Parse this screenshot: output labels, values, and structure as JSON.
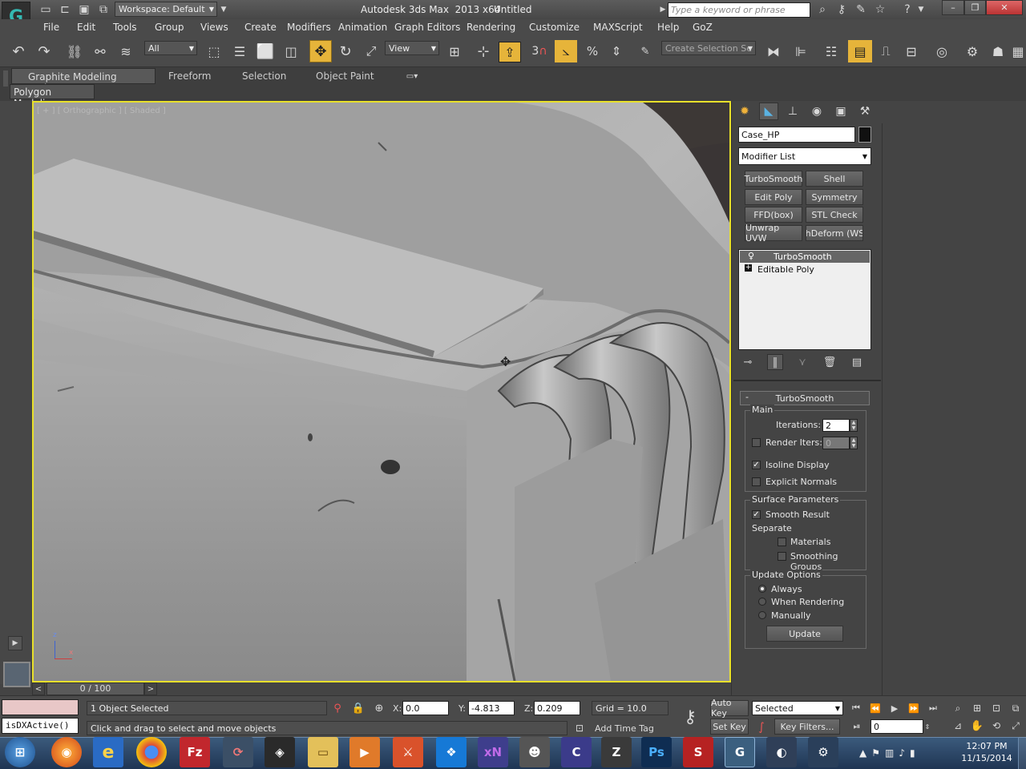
{
  "titlebar": {
    "workspace": "Workspace: Default",
    "app_title": "Autodesk 3ds Max  2013 x64",
    "doc_title": "Untitled",
    "search_placeholder": "Type a keyword or phrase"
  },
  "menubar": {
    "items": [
      "File",
      "Edit",
      "Tools",
      "Group",
      "Views",
      "Create",
      "Modifiers",
      "Animation",
      "Graph Editors",
      "Rendering",
      "Customize",
      "MAXScript",
      "Help",
      "GoZ"
    ]
  },
  "toolbar": {
    "selection_filter": "All",
    "reference_coord": "View",
    "snap_value": "3",
    "named_selection_placeholder": "Create Selection Se"
  },
  "ribbon": {
    "tabs": [
      "Graphite Modeling Tools",
      "Freeform",
      "Selection",
      "Object Paint"
    ],
    "sub_tab": "Polygon Modeling"
  },
  "viewport": {
    "label": "[ + ] [ Orthographic ] [ Shaded ]",
    "axis_x": "x",
    "axis_z": "z"
  },
  "command_panel": {
    "object_name": "Case_HP",
    "object_color": "#111111",
    "modifier_list": "Modifier List",
    "modifier_buttons": [
      "TurboSmooth",
      "Shell",
      "Edit Poly",
      "Symmetry",
      "FFD(box)",
      "STL Check",
      "Unwrap UVW",
      "thDeform (WSI"
    ],
    "stack": [
      {
        "name": "TurboSmooth",
        "selected": true
      },
      {
        "name": "Editable Poly",
        "selected": false
      }
    ]
  },
  "turbosmooth": {
    "rollout_title": "TurboSmooth",
    "collapse_symbol": "-",
    "main_label": "Main",
    "iterations_label": "Iterations:",
    "iterations_value": "2",
    "render_iters_label": "Render Iters:",
    "render_iters_value": "0",
    "render_iters_checked": false,
    "isoline_label": "Isoline Display",
    "isoline_checked": true,
    "explicit_normals_label": "Explicit Normals",
    "explicit_normals_checked": false,
    "surface_label": "Surface Parameters",
    "smooth_result_label": "Smooth Result",
    "smooth_result_checked": true,
    "separate_label": "Separate",
    "materials_label": "Materials",
    "materials_checked": false,
    "smoothing_groups_label": "Smoothing Groups",
    "smoothing_groups_checked": false,
    "update_options_label": "Update Options",
    "always_label": "Always",
    "when_rendering_label": "When Rendering",
    "manually_label": "Manually",
    "update_option_selected": "Always",
    "update_button": "Update"
  },
  "timeline": {
    "frame": "0 / 100"
  },
  "statusbar": {
    "selection_status": "1 Object Selected",
    "prompt": "Click and drag to select and move objects",
    "x_label": "X:",
    "x_value": "0.0",
    "y_label": "Y:",
    "y_value": "-4.813",
    "z_label": "Z:",
    "z_value": "0.209",
    "grid": "Grid = 10.0",
    "add_time_tag": "Add Time Tag",
    "auto_key": "Auto Key",
    "set_key": "Set Key",
    "key_mode": "Selected",
    "key_filters": "Key Filters...",
    "current_frame": "0",
    "maxscript_listener": "isDXActive()"
  },
  "taskbar": {
    "time": "12:07 PM",
    "date": "11/15/2014",
    "apps": [
      "windows-start",
      "firefox",
      "internet-explorer",
      "chrome",
      "filezilla",
      "app-swirl",
      "unity",
      "file-explorer",
      "media-player",
      "app-red",
      "dropbox",
      "xnview",
      "gimp",
      "app-c",
      "zbrush",
      "photoshop",
      "substance",
      "3dsmax",
      "app-circle",
      "app-settings"
    ]
  }
}
